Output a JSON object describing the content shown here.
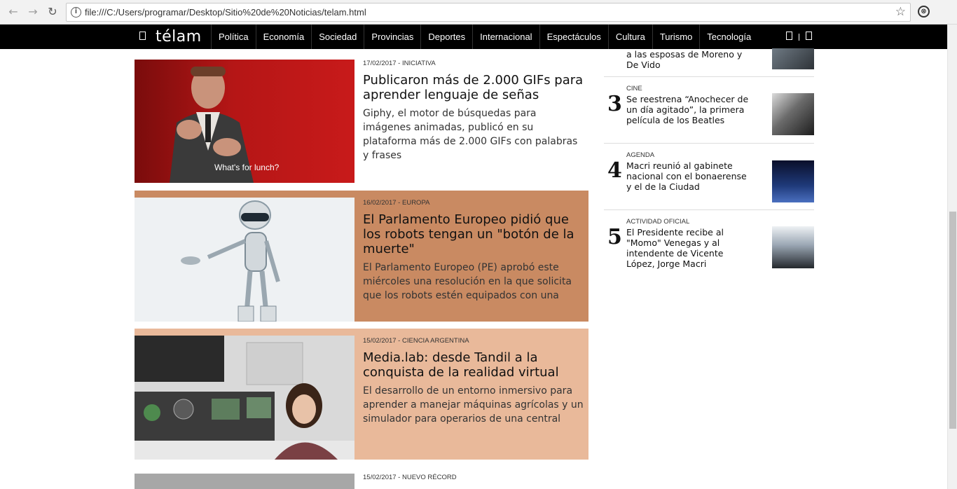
{
  "browser": {
    "url": "file:///C:/Users/programar/Desktop/Sitio%20de%20Noticias/telam.html"
  },
  "site": {
    "logo": "télam",
    "nav": [
      "Política",
      "Economía",
      "Sociedad",
      "Provincias",
      "Deportes",
      "Internacional",
      "Espectáculos",
      "Cultura",
      "Turismo",
      "Tecnología"
    ]
  },
  "articles": [
    {
      "date": "17/02/2017",
      "section": "INICIATIVA",
      "title": "Publicaron más de 2.000 GIFs para aprender lenguaje de señas",
      "summary": "Giphy, el motor de búsquedas para imágenes animadas, publicó en su plataforma más de 2.000 GIFs con palabras y frases",
      "image_caption": "What's for lunch?",
      "bg": "#ffffff"
    },
    {
      "date": "16/02/2017",
      "section": "EUROPA",
      "title": "El Parlamento Europeo pidió que los robots tengan un \"botón de la muerte\"",
      "summary": "El Parlamento Europeo (PE) aprobó este miércoles una resolución en la que solicita que los robots estén equipados con una",
      "bg": "#c98a62"
    },
    {
      "date": "15/02/2017",
      "section": "CIENCIA ARGENTINA",
      "title": "Media.lab: desde Tandil a la conquista de la realidad virtual",
      "summary": "El desarrollo de un entorno inmersivo para aprender a manejar máquinas agrícolas y un simulador para operarios de una central",
      "bg": "#e9b99a"
    },
    {
      "date": "15/02/2017",
      "section": "NUEVO RÉCORD",
      "bg": "#ffffff"
    }
  ],
  "sidebar": [
    {
      "num": "",
      "category": "",
      "title": "a las esposas de Moreno y De Vido"
    },
    {
      "num": "3",
      "category": "CINE",
      "title": "Se reestrena “Anochecer de un día agitado”, la primera película de los Beatles"
    },
    {
      "num": "4",
      "category": "AGENDA",
      "title": "Macri reunió al gabinete nacional con el bonaerense y el de la Ciudad"
    },
    {
      "num": "5",
      "category": "ACTIVIDAD OFICIAL",
      "title": "El Presidente recibe al \"Momo\" Venegas y al intendente de Vicente López, Jorge Macri"
    }
  ]
}
